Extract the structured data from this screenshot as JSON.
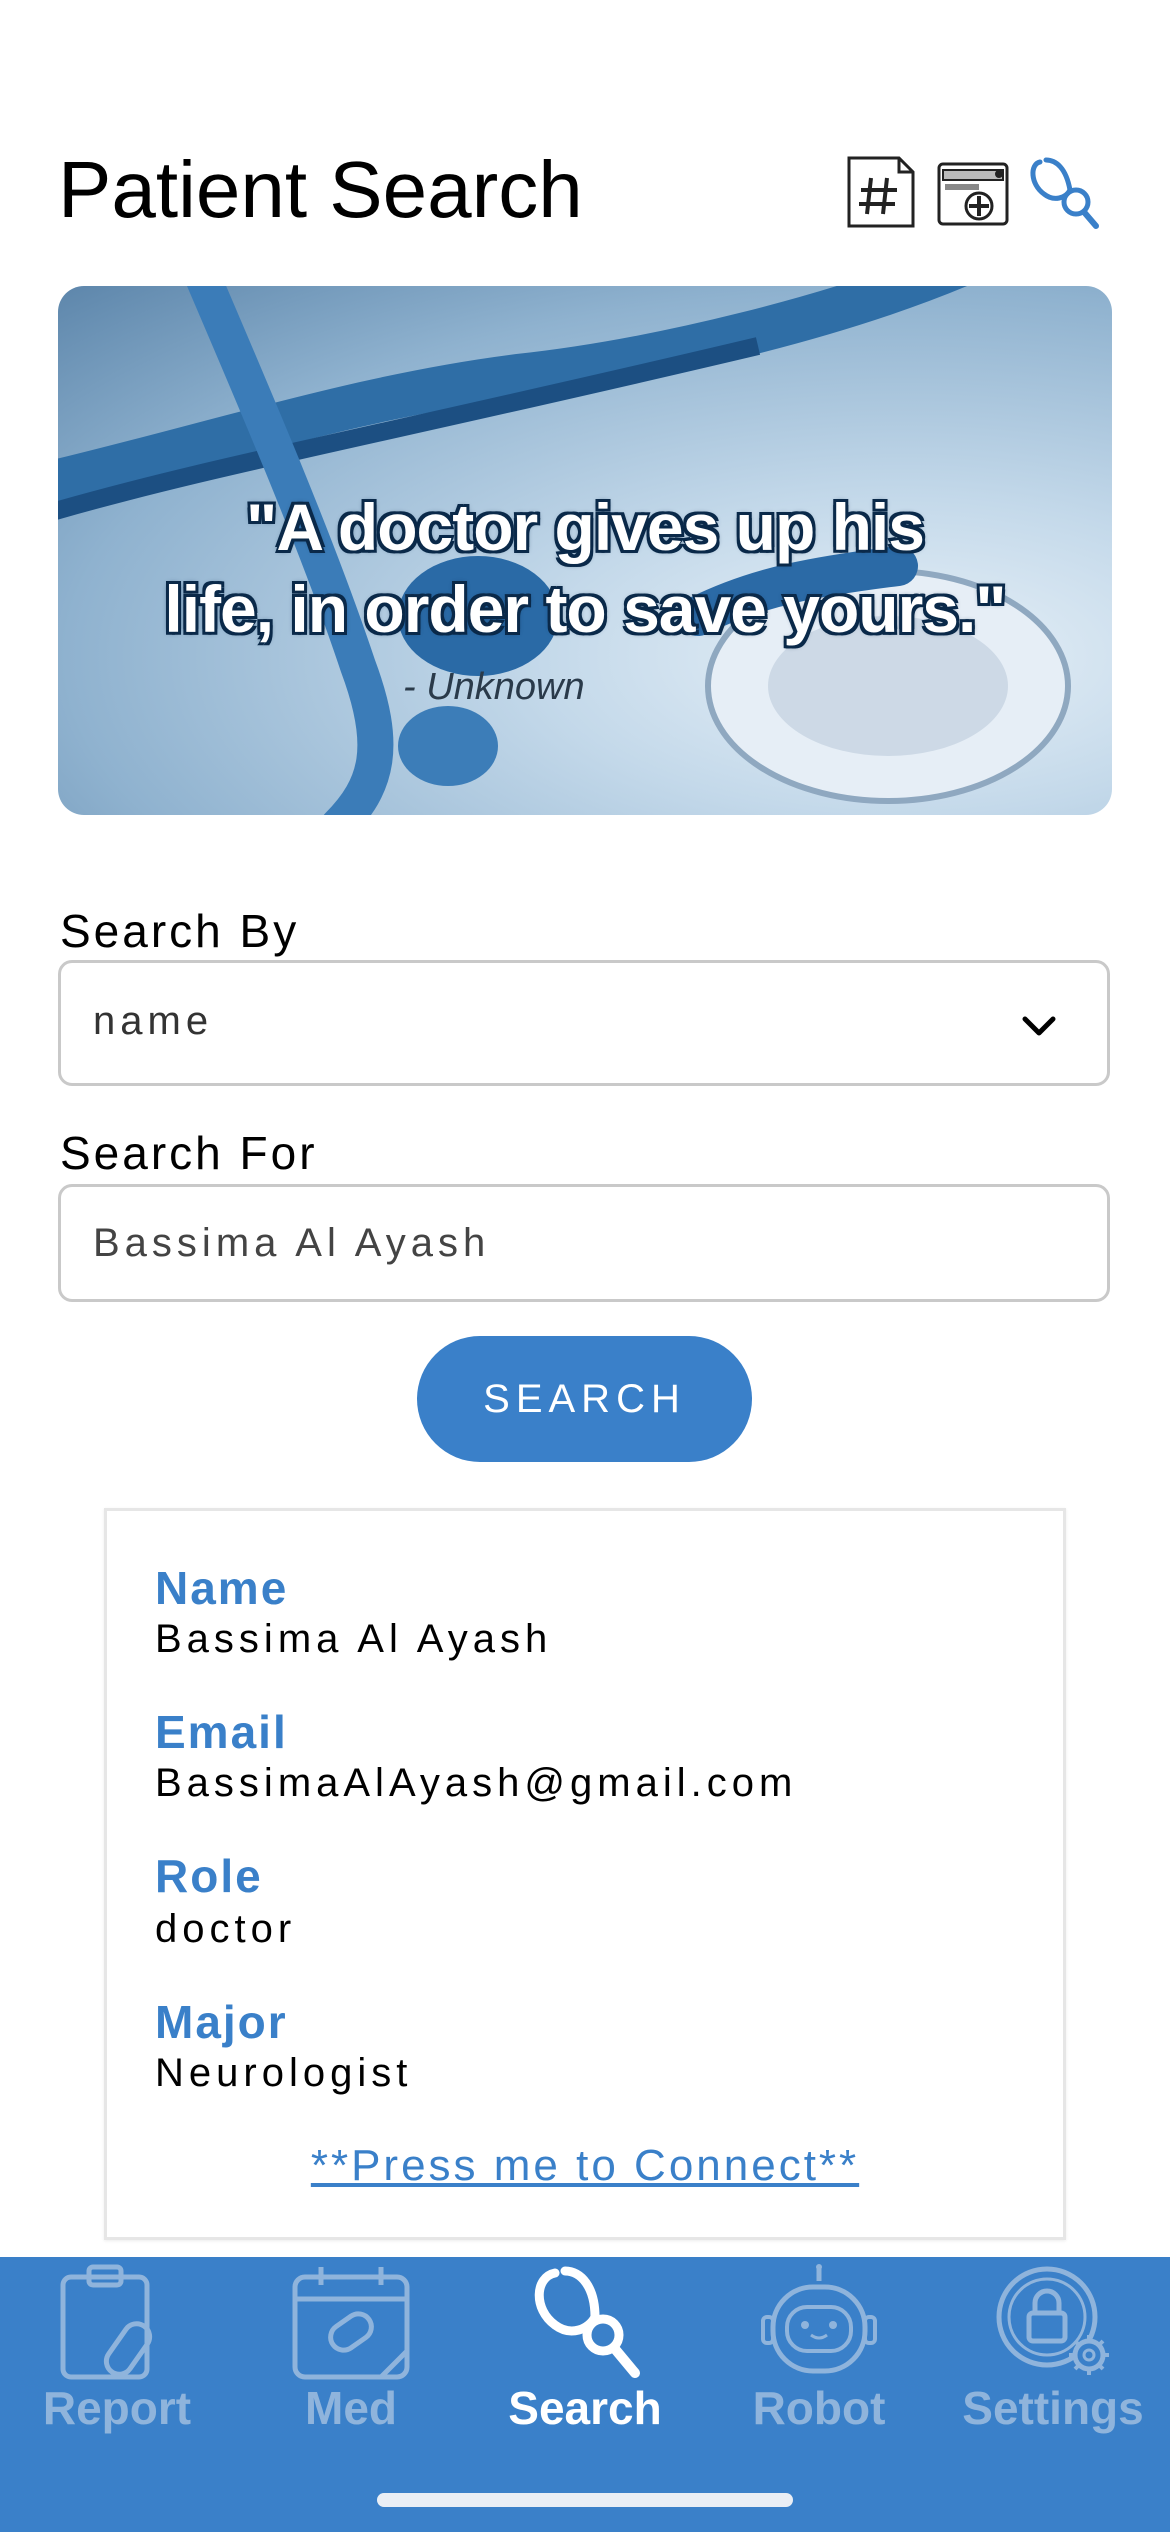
{
  "header": {
    "title": "Patient Search",
    "icons": [
      "hashtag-document-icon",
      "medical-case-icon",
      "stethoscope-icon"
    ]
  },
  "banner": {
    "quote_line1": "\"A doctor gives up his",
    "quote_line2": "life, in order to save yours.\"",
    "author": "- Unknown"
  },
  "form": {
    "search_by_label": "Search By",
    "search_by_value": "name",
    "search_for_label": "Search For",
    "search_for_value": "Bassima Al Ayash",
    "search_button": "SEARCH"
  },
  "result": {
    "name_label": "Name",
    "name_value": "Bassima Al Ayash",
    "email_label": "Email",
    "email_value": "BassimaAlAyash@gmail.com",
    "role_label": "Role",
    "role_value": "doctor",
    "major_label": "Major",
    "major_value": "Neurologist",
    "connect_link": "**Press me to Connect**"
  },
  "tabbar": {
    "tabs": [
      {
        "label": "Report",
        "icon": "clipboard-icon",
        "active": false
      },
      {
        "label": "Med",
        "icon": "calendar-pill-icon",
        "active": false
      },
      {
        "label": "Search",
        "icon": "stethoscope-icon",
        "active": true
      },
      {
        "label": "Robot",
        "icon": "robot-icon",
        "active": false
      },
      {
        "label": "Settings",
        "icon": "lock-gear-icon",
        "active": false
      }
    ]
  },
  "colors": {
    "accent": "#3a80c9",
    "inactive_tab": "#8fb4dc",
    "border": "#c9c9c9"
  }
}
